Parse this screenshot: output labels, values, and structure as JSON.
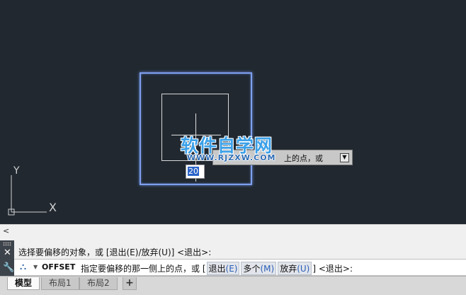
{
  "canvas": {
    "watermark_main": "软件自学网",
    "watermark_url": "WWW.RJZXW.COM",
    "tooltip_text": "上的点，或",
    "dynamic_input_value": "20",
    "ucs_x_label": "X",
    "ucs_y_label": "Y"
  },
  "command": {
    "collapse_label": "<",
    "history": "选择要偏移的对象，或 [退出(E)/放弃(U)] <退出>:",
    "name": "OFFSET",
    "prompt_prefix": "指定要偏移的那一侧上的点，或 [",
    "options": [
      {
        "label": "退出",
        "key": "(E)"
      },
      {
        "label": "多个",
        "key": "(M)"
      },
      {
        "label": "放弃",
        "key": "(U)"
      }
    ],
    "prompt_suffix": "] <退出>:"
  },
  "tabs": {
    "model": "模型",
    "layout1": "布局1",
    "layout2": "布局2",
    "add": "+"
  },
  "colors": {
    "canvas_bg": "#212830",
    "selection_highlight": "#7fa0ee",
    "watermark": "#3aa0e8"
  }
}
